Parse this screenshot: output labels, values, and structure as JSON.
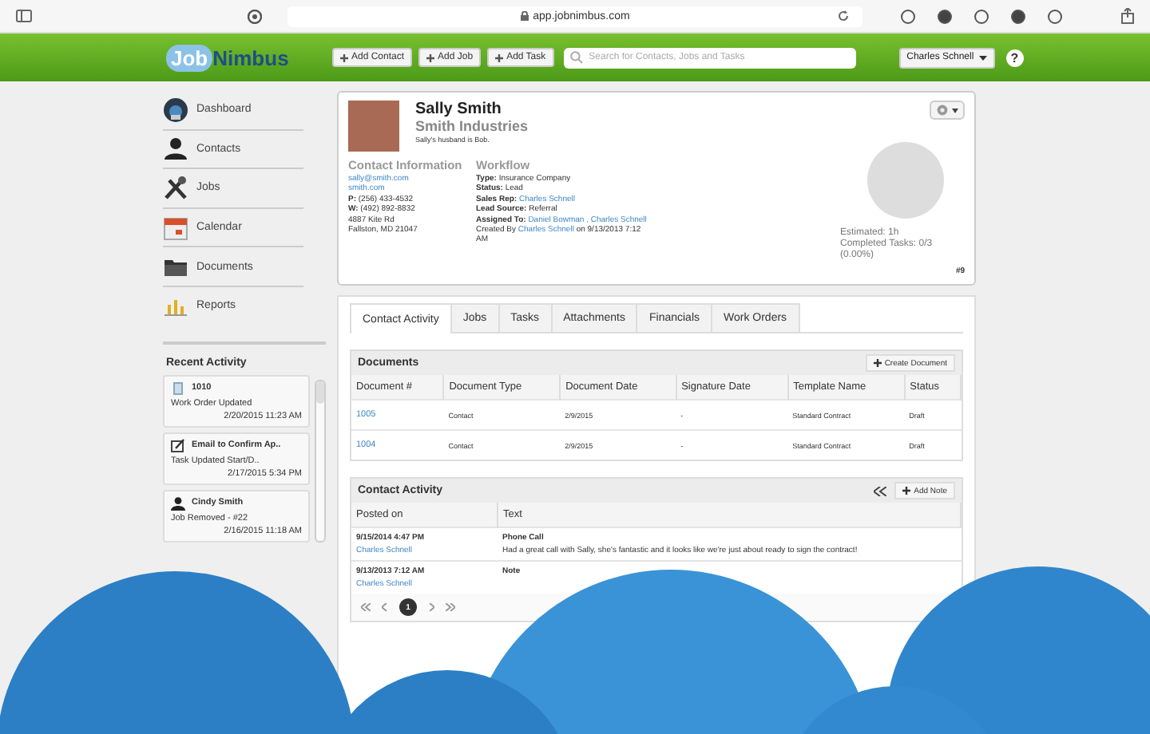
{
  "browser": {
    "url": "app.jobnimbus.com"
  },
  "header": {
    "logo": [
      "Job",
      "Nimbus"
    ],
    "buttons": [
      "Add Contact",
      "Add Job",
      "Add Task"
    ],
    "search": {
      "placeholder": "Search for Contacts, Jobs and Tasks"
    },
    "user": "Charles Schnell",
    "help": "?"
  },
  "sidebar": {
    "nav": [
      {
        "label": "Dashboard"
      },
      {
        "label": "Contacts"
      },
      {
        "label": "Jobs"
      },
      {
        "label": "Calendar"
      },
      {
        "label": "Documents"
      },
      {
        "label": "Reports"
      }
    ],
    "recent_activity": {
      "title": "Recent Activity",
      "items": [
        {
          "title": "1010",
          "detail": "Work Order Updated",
          "time": "2/20/2015 11:23 AM"
        },
        {
          "title": "Email to Confirm Ap..",
          "detail": "Task Updated Start/D..",
          "time": "2/17/2015 5:34 PM"
        },
        {
          "title": "Cindy Smith",
          "detail": "Job Removed - #22",
          "time": "2/16/2015 11:18 AM"
        }
      ]
    }
  },
  "contact": {
    "name": "Sally Smith",
    "company": "Smith Industries",
    "note": "Sally's husband is Bob.",
    "contact_info": {
      "title": "Contact Information",
      "lines": [
        {
          "kind": "link",
          "text": "sally@smith.com"
        },
        {
          "kind": "link",
          "text": "smith.com"
        },
        {
          "kind": "text",
          "text": "**P:** (256) 433-4532"
        },
        {
          "kind": "text",
          "text": "**W:** (492) 892-8832"
        },
        {
          "kind": "text",
          "text": "4887 Kite Rd"
        },
        {
          "kind": "text",
          "text": "Fallston, MD 21047"
        }
      ]
    },
    "workflow": {
      "title": "Workflow",
      "rows": [
        {
          "label": "Type:",
          "value": "Insurance Company",
          "link": false
        },
        {
          "label": "Status:",
          "value": "Lead",
          "link": false
        },
        {
          "label": "Sales Rep:",
          "value": "Charles Schnell",
          "link": true
        },
        {
          "label": "Lead Source:",
          "value": "Referral",
          "link": false
        },
        {
          "label": "Assigned To:",
          "value": "Daniel Bowman , Charles Schnell",
          "link": true
        }
      ],
      "created": {
        "prefix": "Created By",
        "user": "Charles Schnell",
        "suffix": "on 9/13/2013 7:12 AM"
      }
    },
    "progress": {
      "lines": [
        "Estimated: 1h",
        "Completed Tasks: 0/3",
        "(0.00%)"
      ],
      "number": "#9"
    }
  },
  "tabs": [
    {
      "label": "Contact Activity",
      "selected": true
    },
    {
      "label": "Jobs",
      "selected": false
    },
    {
      "label": "Tasks",
      "selected": false
    },
    {
      "label": "Attachments",
      "selected": false
    },
    {
      "label": "Financials",
      "selected": false
    },
    {
      "label": "Work Orders",
      "selected": false
    }
  ],
  "documents": {
    "title": "Documents",
    "action": "Create Document",
    "columns": [
      "Document #",
      "Document Type",
      "Document Date",
      "Signature Date",
      "Template Name",
      "Status"
    ],
    "rows": [
      [
        "1005",
        "Contact",
        "2/9/2015",
        "-",
        "Standard Contract",
        "Draft"
      ],
      [
        "1004",
        "Contact",
        "2/9/2015",
        "-",
        "Standard Contract",
        "Draft"
      ]
    ]
  },
  "activity": {
    "title": "Contact Activity",
    "action": "Add Note",
    "columns": [
      "Posted on",
      "Text"
    ],
    "rows": [
      {
        "posted": "9/15/2014 4:47 PM",
        "author": "Charles Schnell",
        "title": "Phone Call",
        "text": "Had a great call with Sally, she's fantastic and it looks like we're just about ready to sign the contract!"
      },
      {
        "posted": "9/13/2013 7:12 AM",
        "author": "Charles Schnell",
        "title": "Note"
      }
    ]
  },
  "pagination": {
    "pages": [
      {
        "label": "1",
        "selected": true
      }
    ]
  }
}
